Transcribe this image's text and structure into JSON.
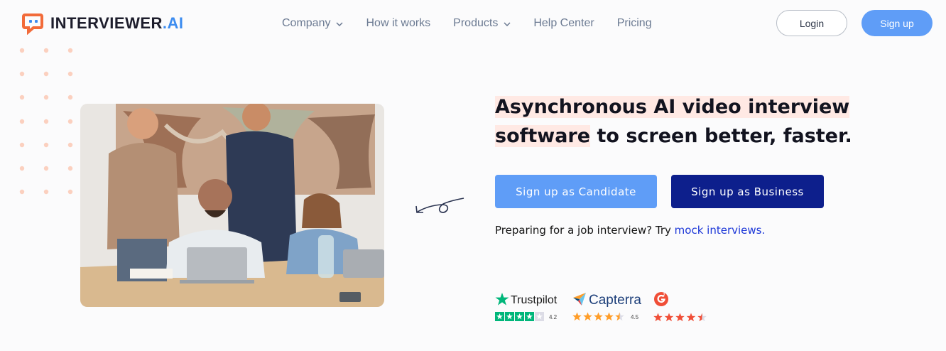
{
  "brand": {
    "name_main": "INTERVIEWER",
    "name_suffix": ".AI"
  },
  "nav": {
    "items": [
      {
        "label": "Company",
        "has_dropdown": true
      },
      {
        "label": "How it works",
        "has_dropdown": false
      },
      {
        "label": "Products",
        "has_dropdown": true
      },
      {
        "label": "Help Center",
        "has_dropdown": false
      },
      {
        "label": "Pricing",
        "has_dropdown": false
      }
    ],
    "login_label": "Login",
    "signup_label": "Sign up"
  },
  "hero": {
    "headline_highlight_1": "Asynchronous AI video interview",
    "headline_highlight_2": "software",
    "headline_rest": " to screen better, faster.",
    "candidate_button": "Sign up as Candidate",
    "business_button": "Sign up as Business",
    "mock_prefix": "Preparing for a job interview? Try ",
    "mock_link": "mock interviews."
  },
  "ratings": [
    {
      "brand": "Trustpilot",
      "score": "4.2",
      "stars": 4.2
    },
    {
      "brand": "Capterra",
      "score": "4.5",
      "stars": 4.5
    },
    {
      "brand": "G2",
      "score": "",
      "stars": 4.5
    }
  ],
  "colors": {
    "accent": "#5f9df7",
    "business": "#0d1f8c",
    "link": "#1d38d8",
    "highlight": "#ffe9e4",
    "logo_orange": "#f26b3a",
    "trustpilot_green": "#00b67a",
    "capterra_star": "#ff9d28",
    "g2_red": "#f04e37"
  },
  "icons": {
    "logo": "chat-bubble-logo-icon",
    "nav_dropdown": "chevron-down-icon",
    "decor_arrow": "curly-arrow-icon",
    "trustpilot": "trustpilot-star-icon",
    "capterra": "capterra-flag-icon",
    "g2": "g2-logo-icon"
  }
}
